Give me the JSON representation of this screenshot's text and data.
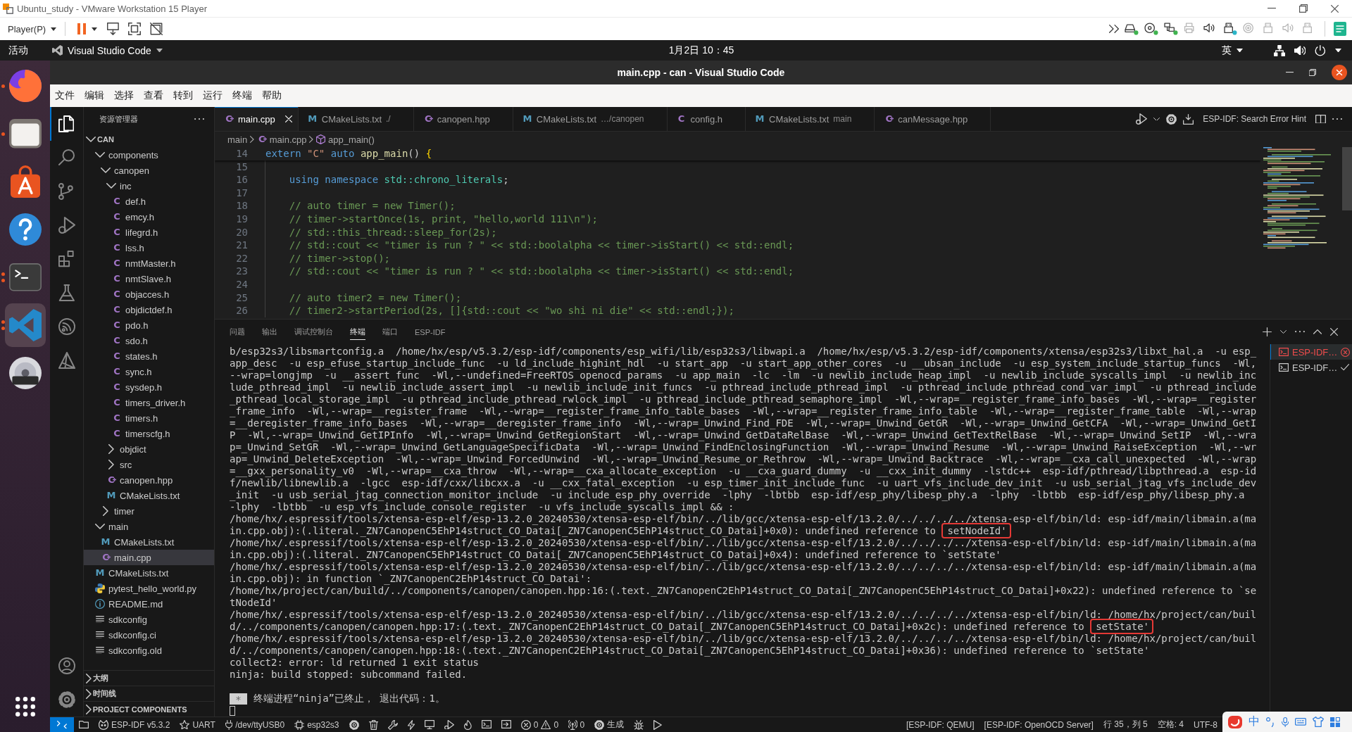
{
  "vmware": {
    "title": "Ubuntu_study - VMware Workstation 15 Player",
    "player_menu": "Player(P)",
    "devices": [
      {
        "kind": "hard-disk",
        "connected": true,
        "disabled": false
      },
      {
        "kind": "cd",
        "connected": true,
        "disabled": false
      },
      {
        "kind": "network",
        "connected": true,
        "disabled": false
      },
      {
        "kind": "printer",
        "connected": false,
        "disabled": true
      },
      {
        "kind": "sound",
        "connected": false,
        "disabled": false
      },
      {
        "kind": "usb",
        "connected": true,
        "disabled": false
      },
      {
        "kind": "disc",
        "connected": false,
        "disabled": true
      },
      {
        "kind": "usb",
        "connected": false,
        "disabled": true
      },
      {
        "kind": "sound",
        "connected": false,
        "disabled": true
      },
      {
        "kind": "usb",
        "connected": false,
        "disabled": true
      }
    ]
  },
  "top_bar": {
    "activities": "活动",
    "app_menu": "Visual Studio Code",
    "clock": "1月2日 10：45",
    "input_source": "英"
  },
  "dock": {
    "items": [
      {
        "kind": "browser",
        "running": true,
        "multiple_windows": false,
        "selected": false
      },
      {
        "kind": "files",
        "running": true,
        "multiple_windows": false,
        "selected": false
      },
      {
        "kind": "software",
        "running": false,
        "selected": false
      },
      {
        "kind": "help",
        "running": false,
        "selected": false
      },
      {
        "kind": "terminal",
        "running": true,
        "multiple_windows": true,
        "selected": false
      },
      {
        "kind": "code-editor",
        "running": true,
        "multiple_windows": true,
        "selected": true
      },
      {
        "kind": "dvd",
        "running": false,
        "selected": false
      }
    ]
  },
  "window": {
    "title": "main.cpp - can - Visual Studio Code",
    "menu": [
      "文件",
      "编辑",
      "选择",
      "查看",
      "转到",
      "运行",
      "终端",
      "帮助"
    ]
  },
  "activity_bar": {
    "items": [
      {
        "kind": "explorer",
        "selected": true
      },
      {
        "kind": "search",
        "selected": false
      },
      {
        "kind": "source-control",
        "selected": false
      },
      {
        "kind": "run-debug",
        "selected": false
      },
      {
        "kind": "extensions",
        "selected": false
      },
      {
        "kind": "testing",
        "selected": false
      },
      {
        "kind": "esp-idf",
        "selected": false
      },
      {
        "kind": "cmake",
        "selected": false
      }
    ],
    "bottom": [
      {
        "kind": "account"
      },
      {
        "kind": "settings"
      }
    ]
  },
  "explorer": {
    "title": "资源管理器",
    "root": {
      "label": "CAN",
      "expanded": true,
      "children": [
        {
          "kind": "folder",
          "label": "components",
          "expanded": true,
          "selected": false,
          "children": [
            {
              "kind": "folder",
              "label": "canopen",
              "expanded": true,
              "selected": false,
              "children": [
                {
                  "kind": "folder",
                  "label": "inc",
                  "expanded": true,
                  "selected": false,
                  "children": [
                    {
                      "kind": "c",
                      "icon": "C",
                      "label": "def.h",
                      "selected": false
                    },
                    {
                      "kind": "c",
                      "icon": "C",
                      "label": "emcy.h",
                      "selected": false
                    },
                    {
                      "kind": "c",
                      "icon": "C",
                      "label": "lifegrd.h",
                      "selected": false
                    },
                    {
                      "kind": "c",
                      "icon": "C",
                      "label": "lss.h",
                      "selected": false
                    },
                    {
                      "kind": "c",
                      "icon": "C",
                      "label": "nmtMaster.h",
                      "selected": false
                    },
                    {
                      "kind": "c",
                      "icon": "C",
                      "label": "nmtSlave.h",
                      "selected": false
                    },
                    {
                      "kind": "c",
                      "icon": "C",
                      "label": "objacces.h",
                      "selected": false
                    },
                    {
                      "kind": "c",
                      "icon": "C",
                      "label": "objdictdef.h",
                      "selected": false
                    },
                    {
                      "kind": "c",
                      "icon": "C",
                      "label": "pdo.h",
                      "selected": false
                    },
                    {
                      "kind": "c",
                      "icon": "C",
                      "label": "sdo.h",
                      "selected": false
                    },
                    {
                      "kind": "c",
                      "icon": "C",
                      "label": "states.h",
                      "selected": false
                    },
                    {
                      "kind": "c",
                      "icon": "C",
                      "label": "sync.h",
                      "selected": false
                    },
                    {
                      "kind": "c",
                      "icon": "C",
                      "label": "sysdep.h",
                      "selected": false
                    },
                    {
                      "kind": "c",
                      "icon": "C",
                      "label": "timers_driver.h",
                      "selected": false
                    },
                    {
                      "kind": "c",
                      "icon": "C",
                      "label": "timers.h",
                      "selected": false
                    },
                    {
                      "kind": "c",
                      "icon": "C",
                      "label": "timerscfg.h",
                      "selected": false
                    }
                  ]
                },
                {
                  "kind": "folder",
                  "label": "objdict",
                  "expanded": false,
                  "selected": false
                },
                {
                  "kind": "folder",
                  "label": "src",
                  "expanded": false,
                  "selected": false
                },
                {
                  "kind": "cpp",
                  "icon": "C",
                  "label": "canopen.hpp",
                  "selected": false
                },
                {
                  "kind": "cmake",
                  "icon": "M",
                  "label": "CMakeLists.txt",
                  "selected": false
                }
              ]
            },
            {
              "kind": "folder",
              "label": "timer",
              "expanded": false,
              "selected": false
            }
          ]
        },
        {
          "kind": "folder",
          "label": "main",
          "expanded": true,
          "selected": false,
          "children": [
            {
              "kind": "cmake",
              "icon": "M",
              "label": "CMakeLists.txt",
              "selected": false
            },
            {
              "kind": "cpp",
              "icon": "C",
              "label": "main.cpp",
              "selected": true
            }
          ]
        },
        {
          "kind": "cmake",
          "icon": "M",
          "label": "CMakeLists.txt",
          "selected": false
        },
        {
          "kind": "python",
          "label": "pytest_hello_world.py",
          "selected": false
        },
        {
          "kind": "info",
          "label": "README.md",
          "selected": false
        },
        {
          "kind": "text",
          "label": "sdkconfig",
          "selected": false
        },
        {
          "kind": "text",
          "label": "sdkconfig.ci",
          "selected": false
        },
        {
          "kind": "text",
          "label": "sdkconfig.old",
          "selected": false
        }
      ]
    },
    "sections": [
      {
        "label": "大纲",
        "expanded": false
      },
      {
        "label": "时间线",
        "expanded": false
      },
      {
        "label": "PROJECT COMPONENTS",
        "expanded": false
      }
    ]
  },
  "tabs": [
    {
      "kind": "cpp",
      "icon": "C",
      "label": "main.cpp",
      "selected": true
    },
    {
      "kind": "cmake",
      "icon": "M",
      "label": "CMakeLists.txt",
      "description": "./",
      "selected": false
    },
    {
      "kind": "cpp",
      "icon": "C",
      "label": "canopen.hpp",
      "selected": false
    },
    {
      "kind": "cmake",
      "icon": "M",
      "label": "CMakeLists.txt",
      "description": "…/canopen",
      "selected": false
    },
    {
      "kind": "c",
      "icon": "C",
      "label": "config.h",
      "selected": false
    },
    {
      "kind": "cmake",
      "icon": "M",
      "label": "CMakeLists.txt",
      "description": "main",
      "selected": false
    },
    {
      "kind": "cpp",
      "icon": "C",
      "label": "canMessage.hpp",
      "selected": false
    }
  ],
  "tab_actions": {
    "hint": "ESP-IDF: Search Error Hint"
  },
  "editor": {
    "breadcrumb": [
      {
        "kind": "folder",
        "label": "main"
      },
      {
        "kind": "cpp",
        "icon": "C",
        "label": "main.cpp"
      },
      {
        "kind": "symbol",
        "label": "app_main()"
      }
    ],
    "lines": [
      {
        "number": "14",
        "tokens": [
          {
            "kind": "keyword",
            "text": "extern "
          },
          {
            "kind": "string",
            "text": "\"C\" "
          },
          {
            "kind": "keyword",
            "text": "auto "
          },
          {
            "kind": "function",
            "text": "app_main"
          },
          {
            "kind": "plain",
            "text": "() "
          },
          {
            "kind": "bracket",
            "text": "{"
          }
        ]
      },
      {
        "number": "15"
      },
      {
        "number": "16",
        "tokens": [
          {
            "kind": "keyword",
            "text": "    using namespace "
          },
          {
            "kind": "type",
            "text": "std::chrono_literals"
          },
          {
            "kind": "plain",
            "text": ";"
          }
        ]
      },
      {
        "number": "17"
      },
      {
        "number": "18",
        "tokens": [
          {
            "kind": "comment",
            "text": "    // auto timer = new Timer();"
          }
        ]
      },
      {
        "number": "19",
        "tokens": [
          {
            "kind": "comment",
            "text": "    // timer->startOnce(1s, print, \"hello,world 111\\n\");"
          }
        ]
      },
      {
        "number": "20",
        "tokens": [
          {
            "kind": "comment",
            "text": "    // std::this_thread::sleep_for(2s);"
          }
        ]
      },
      {
        "number": "21",
        "tokens": [
          {
            "kind": "comment",
            "text": "    // std::cout << \"timer is run ? \" << std::boolalpha << timer->isStart() << std::endl;"
          }
        ]
      },
      {
        "number": "22",
        "tokens": [
          {
            "kind": "comment",
            "text": "    // timer->stop();"
          }
        ]
      },
      {
        "number": "23",
        "tokens": [
          {
            "kind": "comment",
            "text": "    // std::cout << \"timer is run ? \" << std::boolalpha << timer->isStart() << std::endl;"
          }
        ]
      },
      {
        "number": "24"
      },
      {
        "number": "25",
        "tokens": [
          {
            "kind": "comment",
            "text": "    // auto timer2 = new Timer();"
          }
        ]
      },
      {
        "number": "26",
        "tokens": [
          {
            "kind": "comment",
            "text": "    // timer2->startPeriod(2s, []{std::cout << \"wo shi ni die\" << std::endl;});"
          }
        ]
      }
    ]
  },
  "panel": {
    "tabs": [
      {
        "label": "问题",
        "selected": false
      },
      {
        "label": "输出",
        "selected": false
      },
      {
        "label": "调试控制台",
        "selected": false
      },
      {
        "label": "终端",
        "selected": true
      },
      {
        "label": "端口",
        "selected": false
      },
      {
        "label": "ESP-IDF",
        "selected": false
      }
    ],
    "terminal": {
      "lines": [
        {
          "text": "b/esp32s3/libsmartconfig.a  /home/hx/esp/v5.3.2/esp-idf/components/esp_wifi/lib/esp32s3/libwapi.a  /home/hx/esp/v5.3.2/esp-idf/components/xtensa/esp32s3/libxt_hal.a  -u esp_"
        },
        {
          "text": "app_desc  -u esp_efuse_startup_include_func  -u ld_include_highint_hdl  -u start_app  -u start_app_other_cores  -u __ubsan_include  -u esp_system_include_startup_funcs  -Wl,"
        },
        {
          "text": "--wrap=longjmp  -u __assert_func  -Wl,--undefined=FreeRTOS_openocd_params  -u app_main  -lc  -lm  -u newlib_include_heap_impl  -u newlib_include_syscalls_impl  -u newlib_inc"
        },
        {
          "text": "lude_pthread_impl  -u newlib_include_assert_impl  -u newlib_include_init_funcs  -u pthread_include_pthread_impl  -u pthread_include_pthread_cond_var_impl  -u pthread_include"
        },
        {
          "text": "_pthread_local_storage_impl  -u pthread_include_pthread_rwlock_impl  -u pthread_include_pthread_semaphore_impl  -Wl,--wrap=__register_frame_info_bases  -Wl,--wrap=__register"
        },
        {
          "text": "_frame_info  -Wl,--wrap=__register_frame  -Wl,--wrap=__register_frame_info_table_bases  -Wl,--wrap=__register_frame_info_table  -Wl,--wrap=__register_frame_table  -Wl,--wrap"
        },
        {
          "text": "=__deregister_frame_info_bases  -Wl,--wrap=__deregister_frame_info  -Wl,--wrap=_Unwind_Find_FDE  -Wl,--wrap=_Unwind_GetGR  -Wl,--wrap=_Unwind_GetCFA  -Wl,--wrap=_Unwind_GetI"
        },
        {
          "text": "P  -Wl,--wrap=_Unwind_GetIPInfo  -Wl,--wrap=_Unwind_GetRegionStart  -Wl,--wrap=_Unwind_GetDataRelBase  -Wl,--wrap=_Unwind_GetTextRelBase  -Wl,--wrap=_Unwind_SetIP  -Wl,--wra"
        },
        {
          "text": "p=_Unwind_SetGR  -Wl,--wrap=_Unwind_GetLanguageSpecificData  -Wl,--wrap=_Unwind_FindEnclosingFunction  -Wl,--wrap=_Unwind_Resume  -Wl,--wrap=_Unwind_RaiseException  -Wl,--wr"
        },
        {
          "text": "ap=_Unwind_DeleteException  -Wl,--wrap=_Unwind_ForcedUnwind  -Wl,--wrap=_Unwind_Resume_or_Rethrow  -Wl,--wrap=_Unwind_Backtrace  -Wl,--wrap=__cxa_call_unexpected  -Wl,--wrap"
        },
        {
          "text": "=__gxx_personality_v0  -Wl,--wrap=__cxa_throw  -Wl,--wrap=__cxa_allocate_exception  -u __cxa_guard_dummy  -u __cxx_init_dummy  -lstdc++  esp-idf/pthread/libpthread.a  esp-id"
        },
        {
          "text": "f/newlib/libnewlib.a  -lgcc  esp-idf/cxx/libcxx.a  -u __cxx_fatal_exception  -u esp_timer_init_include_func  -u uart_vfs_include_dev_init  -u usb_serial_jtag_vfs_include_dev"
        },
        {
          "text": "_init  -u usb_serial_jtag_connection_monitor_include  -u include_esp_phy_override  -lphy  -lbtbb  esp-idf/esp_phy/libesp_phy.a  -lphy  -lbtbb  esp-idf/esp_phy/libesp_phy.a"
        },
        {
          "text": "-lphy  -lbtbb  -u esp_vfs_include_console_register  -u vfs_include_syscalls_impl && :"
        },
        {
          "text": "/home/hx/.espressif/tools/xtensa-esp-elf/esp-13.2.0_20240530/xtensa-esp-elf/bin/../lib/gcc/xtensa-esp-elf/13.2.0/../../../../xtensa-esp-elf/bin/ld: esp-idf/main/libmain.a(ma"
        },
        {
          "text": "in.cpp.obj):(.literal._ZN7CanopenC5EhP14struct_CO_Datai[_ZN7CanopenC5EhP14struct_CO_Datai]+0x0): undefined reference to",
          "boxed": "setNodeId'"
        },
        {
          "text": "/home/hx/.espressif/tools/xtensa-esp-elf/esp-13.2.0_20240530/xtensa-esp-elf/bin/../lib/gcc/xtensa-esp-elf/13.2.0/../../../../xtensa-esp-elf/bin/ld: esp-idf/main/libmain.a(ma"
        },
        {
          "text": "in.cpp.obj):(.literal._ZN7CanopenC5EhP14struct_CO_Datai[_ZN7CanopenC5EhP14struct_CO_Datai]+0x4): undefined reference to `setState'"
        },
        {
          "text": "/home/hx/.espressif/tools/xtensa-esp-elf/esp-13.2.0_20240530/xtensa-esp-elf/bin/../lib/gcc/xtensa-esp-elf/13.2.0/../../../../xtensa-esp-elf/bin/ld: esp-idf/main/libmain.a(ma"
        },
        {
          "text": "in.cpp.obj): in function `_ZN7CanopenC2EhP14struct_CO_Datai':"
        },
        {
          "text": "/home/hx/project/can/build/../components/canopen/canopen.hpp:16:(.text._ZN7CanopenC2EhP14struct_CO_Datai[_ZN7CanopenC5EhP14struct_CO_Datai]+0x22): undefined reference to `se"
        },
        {
          "text": "tNodeId'"
        },
        {
          "text": "/home/hx/.espressif/tools/xtensa-esp-elf/esp-13.2.0_20240530/xtensa-esp-elf/bin/../lib/gcc/xtensa-esp-elf/13.2.0/../../../../xtensa-esp-elf/bin/ld: /home/hx/project/can/buil"
        },
        {
          "text": "d/../components/canopen/canopen.hpp:17:(.text._ZN7CanopenC2EhP14struct_CO_Datai[_ZN7CanopenC5EhP14struct_CO_Datai]+0x2c): undefined reference to",
          "boxed": "setState'"
        },
        {
          "text": "/home/hx/.espressif/tools/xtensa-esp-elf/esp-13.2.0_20240530/xtensa-esp-elf/bin/../lib/gcc/xtensa-esp-elf/13.2.0/../../../../xtensa-esp-elf/bin/ld: /home/hx/project/can/buil"
        },
        {
          "text": "d/../components/canopen/canopen.hpp:18:(.text._ZN7CanopenC2EhP14struct_CO_Datai[_ZN7CanopenC5EhP14struct_CO_Datai]+0x36): undefined reference to `setState'"
        },
        {
          "text": "collect2: error: ld returned 1 exit status"
        },
        {
          "text": "ninja: build stopped: subcommand failed."
        }
      ],
      "exit_notice": {
        "badge": "*",
        "text": "终端进程“ninja”已终止， 退出代码：1。"
      }
    },
    "terminal_tabs": [
      {
        "label": "ESP-IDF…",
        "failed": true,
        "selected": true
      },
      {
        "label": "ESP-IDF…",
        "failed": false,
        "selected": false
      }
    ]
  },
  "status_bar": {
    "left": [
      {
        "kind": "remote"
      },
      {
        "kind": "folder"
      },
      {
        "kind": "esp-idf",
        "text": "ESP-IDF v5.3.2"
      },
      {
        "kind": "star",
        "text": "UART"
      },
      {
        "kind": "plug",
        "text": "/dev/ttyUSB0"
      },
      {
        "kind": "chip",
        "text": "esp32s3"
      },
      {
        "kind": "gear"
      },
      {
        "kind": "trash"
      },
      {
        "kind": "wrench"
      },
      {
        "kind": "flash"
      },
      {
        "kind": "monitor"
      },
      {
        "kind": "debug"
      },
      {
        "kind": "flame"
      },
      {
        "kind": "terminal"
      },
      {
        "kind": "export"
      },
      {
        "kind": "problems",
        "errors": "0",
        "warnings": "0"
      },
      {
        "kind": "antenna",
        "text": "0"
      },
      {
        "kind": "gear",
        "text": "生成"
      },
      {
        "kind": "bug"
      },
      {
        "kind": "play"
      }
    ],
    "right": [
      "[ESP-IDF: QEMU]",
      "[ESP-IDF: OpenOCD Server]",
      "行 35，列 5",
      "空格: 4",
      "UTF-8"
    ]
  },
  "input_method": {
    "mode": "中"
  }
}
